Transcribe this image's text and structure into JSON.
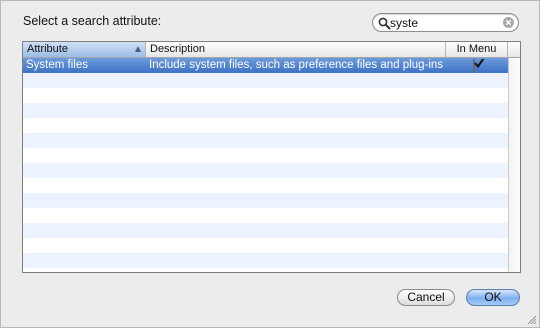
{
  "dialog": {
    "prompt": "Select a search attribute:"
  },
  "search": {
    "value": "syste",
    "icon": "magnifying-glass",
    "clear_icon": "clear-x"
  },
  "table": {
    "columns": [
      "Attribute",
      "Description",
      "In Menu"
    ],
    "sort_column": "Attribute",
    "sort_direction": "ascending",
    "rows": [
      {
        "attribute": "System files",
        "description": "Include system files, such as preference files and plug-ins",
        "in_menu": true,
        "selected": true
      }
    ],
    "selection_color": "#3d72c5",
    "alt_row_color": "#edf3fe"
  },
  "buttons": {
    "cancel": "Cancel",
    "ok": "OK",
    "ok_color": "#7fb1ef"
  }
}
